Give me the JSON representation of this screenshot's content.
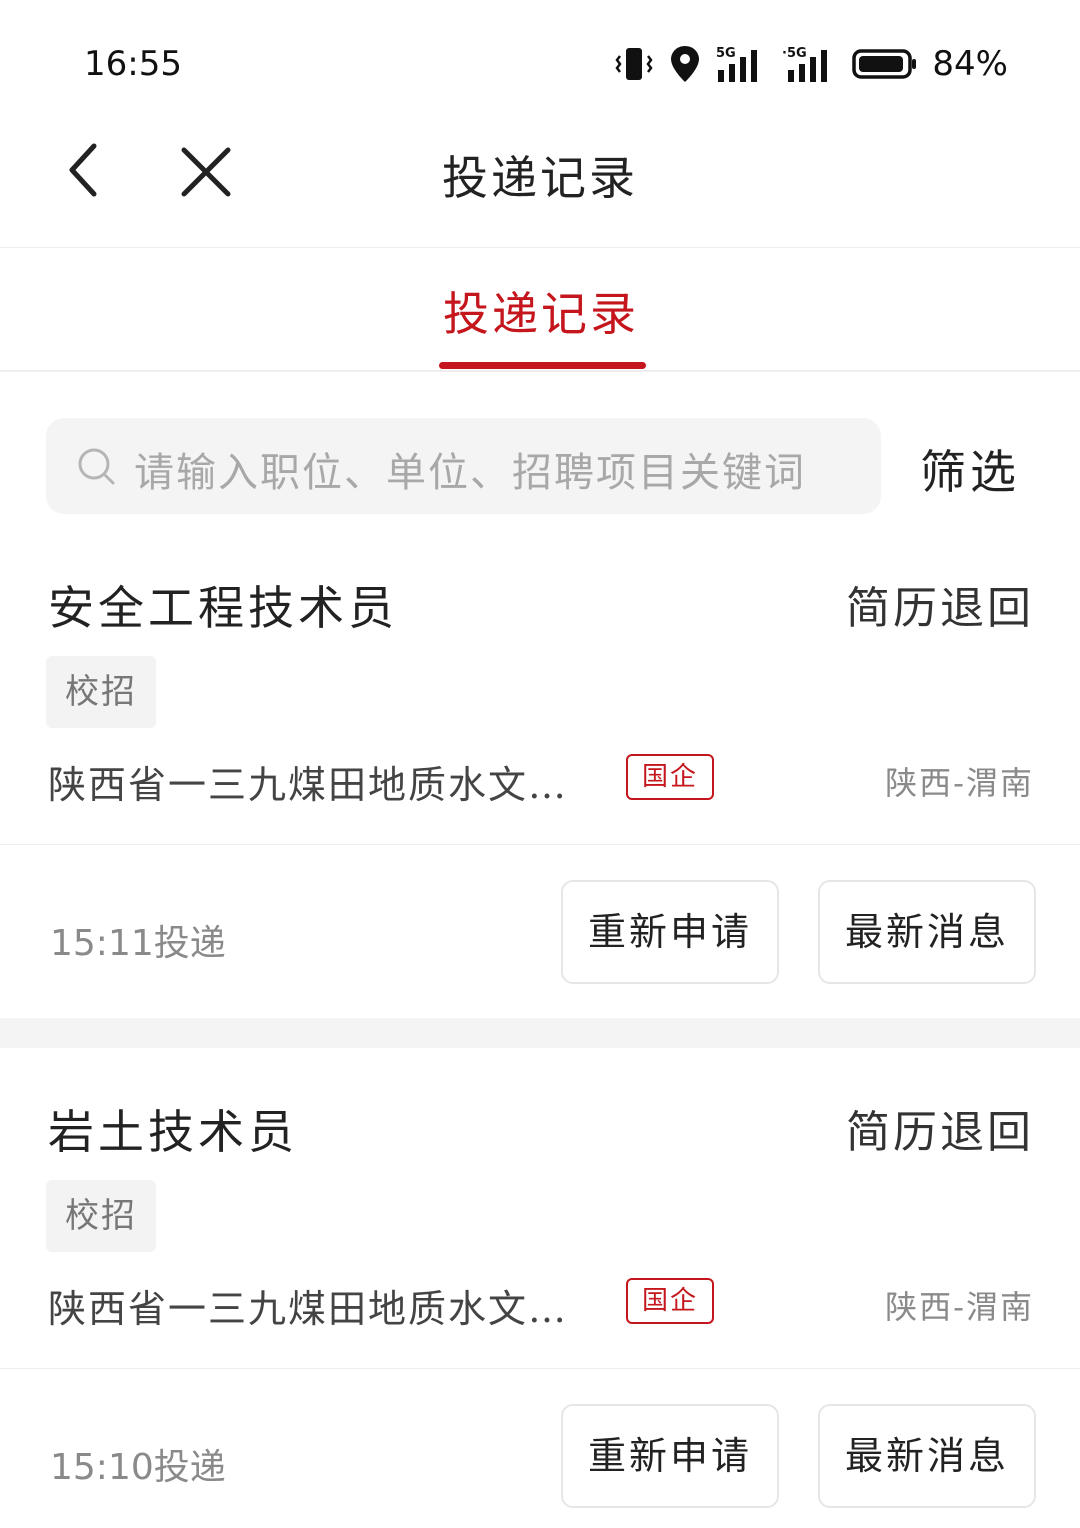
{
  "status_bar": {
    "time": "16:55",
    "battery": "84%"
  },
  "nav": {
    "title": "投递记录"
  },
  "tabs": [
    {
      "label": "投递记录",
      "active": true
    }
  ],
  "search": {
    "placeholder": "请输入职位、单位、招聘项目关键词",
    "filter_label": "筛选"
  },
  "records": [
    {
      "title": "安全工程技术员",
      "status": "简历退回",
      "tag": "校招",
      "company": "陕西省一三九煤田地质水文…",
      "badge": "国企",
      "location": "陕西-渭南",
      "time": "15:11",
      "time_suffix": "投递",
      "reapply_label": "重新申请",
      "latest_label": "最新消息"
    },
    {
      "title": "岩土技术员",
      "status": "简历退回",
      "tag": "校招",
      "company": "陕西省一三九煤田地质水文…",
      "badge": "国企",
      "location": "陕西-渭南",
      "time": "15:10",
      "time_suffix": "投递",
      "reapply_label": "重新申请",
      "latest_label": "最新消息"
    }
  ],
  "colors": {
    "accent": "#c4161c",
    "muted": "#8a8a8a",
    "background_gap": "#f4f4f4"
  }
}
